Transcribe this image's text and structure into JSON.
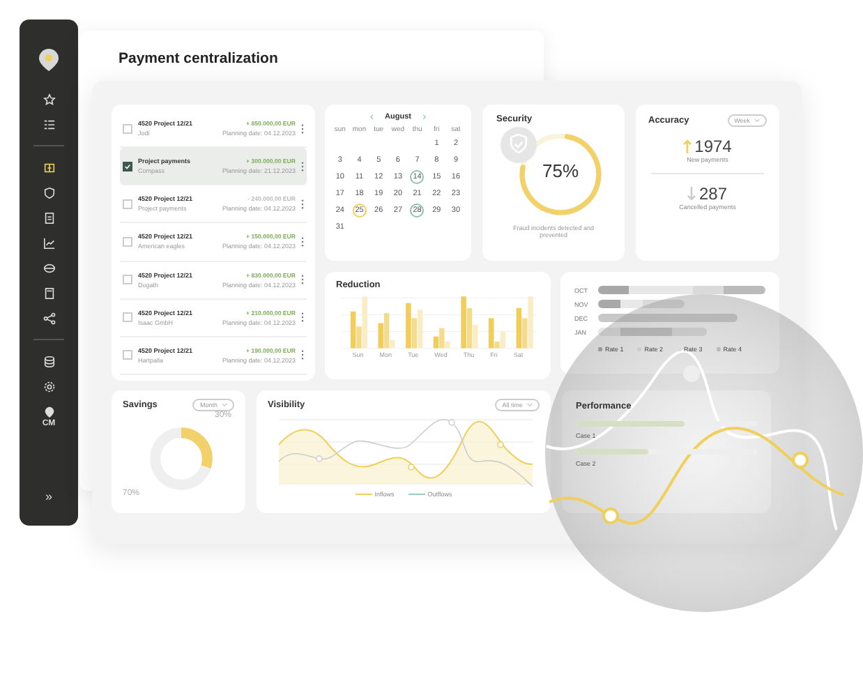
{
  "sidebar": {
    "items": [
      {
        "kind": "star",
        "selected": false
      },
      {
        "kind": "list",
        "selected": false
      },
      {
        "kind": "box",
        "selected": true
      },
      {
        "kind": "shield",
        "selected": false
      },
      {
        "kind": "doc",
        "selected": false
      },
      {
        "kind": "chart",
        "selected": false
      },
      {
        "kind": "layers",
        "selected": false
      },
      {
        "kind": "calc",
        "selected": false
      },
      {
        "kind": "share",
        "selected": false
      },
      {
        "kind": "db",
        "selected": false
      },
      {
        "kind": "gear",
        "selected": false
      }
    ],
    "profile": "CM",
    "expand": "»"
  },
  "back_card": {
    "title": "Payment centralization"
  },
  "payments": [
    {
      "title": "4520 Project 12/21",
      "subtitle": "Jodi",
      "amount": "+ 850.000,00 EUR",
      "kind": "credit",
      "date": "Planning date: 04.12.2023",
      "checked": false,
      "selected": false
    },
    {
      "title": "Project payments",
      "subtitle": "Compass",
      "amount": "+ 300.000,00 EUR",
      "kind": "credit",
      "date": "Planning date: 21.12.2023",
      "checked": true,
      "selected": true
    },
    {
      "title": "4520 Project 12/21",
      "subtitle": "Project payments",
      "amount": "- 240.000,00 EUR",
      "kind": "debit",
      "date": "Planning date: 04.12.2023",
      "checked": false,
      "selected": false
    },
    {
      "title": "4520 Project 12/21",
      "subtitle": "American eagles",
      "amount": "+ 150.000,00 EUR",
      "kind": "credit",
      "date": "Planning date: 04.12.2023",
      "checked": false,
      "selected": false
    },
    {
      "title": "4520 Project 12/21",
      "subtitle": "Dogath",
      "amount": "+ 830.000,00 EUR",
      "kind": "credit",
      "date": "Planning date: 04.12.2023",
      "checked": false,
      "selected": false
    },
    {
      "title": "4520 Project 12/21",
      "subtitle": "Isaac GmbH",
      "amount": "+ 210.000,00 EUR",
      "kind": "credit",
      "date": "Planning date: 04.12.2023",
      "checked": false,
      "selected": false
    },
    {
      "title": "4520 Project 12/21",
      "subtitle": "Hartpalla",
      "amount": "+ 190.000,00 EUR",
      "kind": "credit",
      "date": "Planning date: 04.12.2023",
      "checked": false,
      "selected": false
    }
  ],
  "calendar": {
    "prev": "‹",
    "month": "August",
    "next": "›",
    "weekdays": [
      "sun",
      "mon",
      "tue",
      "wed",
      "thu",
      "fri",
      "sat"
    ],
    "weeks": [
      [
        {
          "d": "1",
          "kind": "plain"
        },
        {
          "d": "2",
          "kind": "plain"
        }
      ],
      [
        {
          "d": "3",
          "kind": "plain"
        },
        {
          "d": "4",
          "kind": "plain"
        },
        {
          "d": "5",
          "kind": "plain"
        },
        {
          "d": "6",
          "kind": "plain"
        },
        {
          "d": "7",
          "kind": "plain"
        },
        {
          "d": "8",
          "kind": "plain"
        },
        {
          "d": "9",
          "kind": "plain"
        }
      ],
      [
        {
          "d": "10",
          "kind": "plain"
        },
        {
          "d": "11",
          "kind": "plain"
        },
        {
          "d": "12",
          "kind": "plain"
        },
        {
          "d": "13",
          "kind": "plain"
        },
        {
          "d": "14",
          "kind": "event"
        },
        {
          "d": "15",
          "kind": "plain"
        },
        {
          "d": "16",
          "kind": "plain"
        }
      ],
      [
        {
          "d": "17",
          "kind": "plain"
        },
        {
          "d": "18",
          "kind": "plain"
        },
        {
          "d": "19",
          "kind": "plain"
        },
        {
          "d": "20",
          "kind": "plain"
        },
        {
          "d": "21",
          "kind": "plain"
        },
        {
          "d": "22",
          "kind": "plain"
        },
        {
          "d": "23",
          "kind": "plain"
        }
      ],
      [
        {
          "d": "24",
          "kind": "plain"
        },
        {
          "d": "25",
          "kind": "today"
        },
        {
          "d": "26",
          "kind": "plain"
        },
        {
          "d": "27",
          "kind": "plain"
        },
        {
          "d": "28",
          "kind": "event"
        },
        {
          "d": "29",
          "kind": "plain"
        },
        {
          "d": "30",
          "kind": "plain"
        }
      ],
      [
        {
          "d": "31",
          "kind": "plain"
        }
      ]
    ]
  },
  "security": {
    "title": "Security",
    "level": 0.75,
    "value": "75%",
    "caption": "Fraud incidents detected and prevented"
  },
  "accuracy": {
    "title": "Accuracy",
    "period": "Week",
    "new_value": "1974",
    "new_label": "New payments",
    "cancelled_value": "287",
    "cancelled_label": "Cancelled payments"
  },
  "reduction": {
    "title": "Reduction",
    "days": [
      "Sun",
      "Mon",
      "Tue",
      "Wed",
      "Thu",
      "Fri",
      "Sat"
    ]
  },
  "months_chart": {
    "rows": [
      "OCT",
      "NOV",
      "DEC",
      "JAN"
    ],
    "legend": [
      "Rate 1",
      "Rate 2",
      "Rate 3",
      "Rate 4"
    ]
  },
  "savings": {
    "title": "Savings",
    "period": "Month",
    "level": 0.3,
    "share_label": "30%",
    "rest_label": "70%"
  },
  "visibility": {
    "title": "Visibility",
    "period": "All time",
    "legend": [
      {
        "label": "Inflows",
        "color": "#f0cf5a"
      },
      {
        "label": "Outflows",
        "color": "#9ccfb9"
      }
    ]
  },
  "performance": {
    "title": "Performance",
    "cases": [
      "Case 1",
      "Case 2"
    ]
  }
}
